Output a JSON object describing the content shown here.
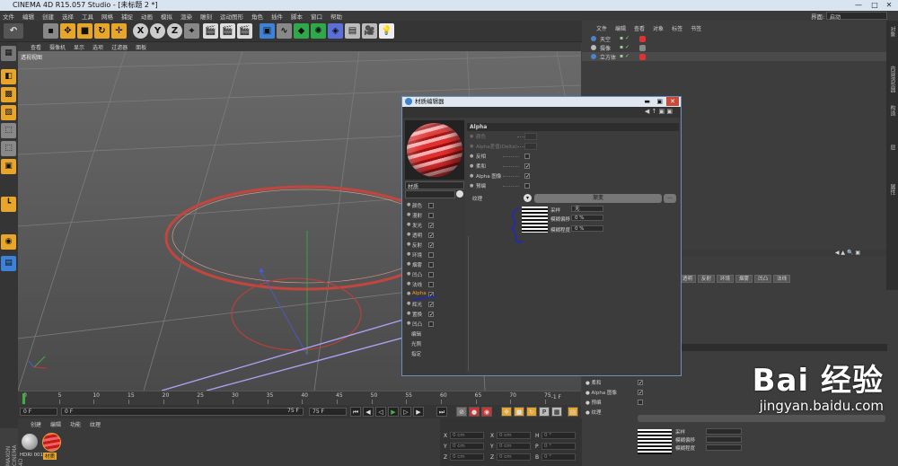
{
  "window": {
    "title": "CINEMA 4D R15.057 Studio - [未标题 2 *]",
    "controls": [
      "—",
      "□",
      "✕"
    ]
  },
  "menu": [
    "文件",
    "编辑",
    "创建",
    "选择",
    "工具",
    "网格",
    "捕捉",
    "动画",
    "模拟",
    "渲染",
    "雕刻",
    "运动图形",
    "角色",
    "插件",
    "脚本",
    "窗口",
    "帮助"
  ],
  "layout": {
    "label": "界面:",
    "value": "启动"
  },
  "toolbar": {
    "x_label": "X",
    "y_label": "Y",
    "z_label": "Z"
  },
  "viewport": {
    "menu": [
      "查看",
      "摄像机",
      "显示",
      "选项",
      "过滤器",
      "面板"
    ],
    "view_name": "透视视图"
  },
  "timeline": {
    "ticks": [
      "0",
      "5",
      "10",
      "15",
      "20",
      "25",
      "30",
      "35",
      "40",
      "45",
      "50",
      "55",
      "60",
      "65",
      "70",
      "75"
    ],
    "end_frame": "-1 F"
  },
  "playback": {
    "start": "0 F",
    "start2": "0 F",
    "end": "75 F",
    "end2": "75 F"
  },
  "material_manager": {
    "menu": [
      "创建",
      "编辑",
      "功能",
      "纹理"
    ],
    "materials": [
      {
        "name": "HDRI 001",
        "color": "#9a9a9a"
      },
      {
        "name": "材质",
        "color": "#e03030"
      }
    ]
  },
  "coords": {
    "rows": [
      {
        "a": "X",
        "av": "0 cm",
        "b": "X",
        "bv": "0 cm",
        "c": "H",
        "cv": "0 °"
      },
      {
        "a": "Y",
        "av": "0 cm",
        "b": "Y",
        "bv": "0 cm",
        "c": "P",
        "cv": "0 °"
      },
      {
        "a": "Z",
        "av": "0 cm",
        "b": "Z",
        "bv": "0 cm",
        "c": "B",
        "cv": "0 °"
      }
    ]
  },
  "objects": {
    "menu": [
      "文件",
      "编辑",
      "查看",
      "对象",
      "标签",
      "书签"
    ],
    "items": [
      {
        "name": "天空",
        "color": "#4a86c7"
      },
      {
        "name": "摄像",
        "color": "#bbbbbb"
      },
      {
        "name": "立方体",
        "color": "#4a86c7"
      }
    ]
  },
  "attributes": {
    "tabs": [
      "颜色",
      "漫射",
      "发光",
      "透明",
      "反射",
      "环境",
      "烟雾",
      "凹凸",
      "法线",
      "Alpha",
      "辉光",
      "置换",
      "编辑"
    ],
    "props": [
      "反相",
      "柔和",
      "Alpha 图像",
      "预编",
      "纹理"
    ],
    "sample": [
      "采样",
      "模糊偏移",
      "模糊程度"
    ]
  },
  "sidebar": [
    "对象",
    "内容浏览器",
    "构造",
    "层",
    "属性"
  ],
  "material_editor": {
    "title": "材质编辑器",
    "material_name": "材质",
    "channels": [
      {
        "name": "颜色",
        "checked": false
      },
      {
        "name": "漫射",
        "checked": false
      },
      {
        "name": "发光",
        "checked": true
      },
      {
        "name": "透明",
        "checked": true
      },
      {
        "name": "反射",
        "checked": true
      },
      {
        "name": "环境",
        "checked": false
      },
      {
        "name": "烟雾",
        "checked": false
      },
      {
        "name": "凹凸",
        "checked": false
      },
      {
        "name": "法线",
        "checked": false
      },
      {
        "name": "Alpha",
        "checked": true,
        "active": true
      },
      {
        "name": "辉光",
        "checked": true
      },
      {
        "name": "置换",
        "checked": true
      },
      {
        "name": "凹凸",
        "checked": false
      },
      {
        "name": "编辑",
        "checked": null
      },
      {
        "name": "光照",
        "checked": null
      },
      {
        "name": "指定",
        "checked": null
      }
    ],
    "section": "Alpha",
    "props": [
      {
        "label": "颜色",
        "dim": true
      },
      {
        "label": "Alpha差值(Delta)",
        "dim": true
      },
      {
        "label": "反相",
        "checked": false
      },
      {
        "label": "柔和",
        "checked": true
      },
      {
        "label": "Alpha 图像",
        "checked": true
      },
      {
        "label": "预编",
        "checked": false
      }
    ],
    "texture_label": "纹理",
    "texture_button": "渐变",
    "sample_label": "采样",
    "sample_value": "无",
    "blur_offset_label": "模糊偏移",
    "blur_offset_value": "0 %",
    "blur_scale_label": "模糊程度",
    "blur_scale_value": "0 %"
  },
  "watermark": {
    "brand": "Bai 经验",
    "url": "jingyan.baidu.com"
  },
  "app_side_label": "MAXON CINEMA 4D"
}
